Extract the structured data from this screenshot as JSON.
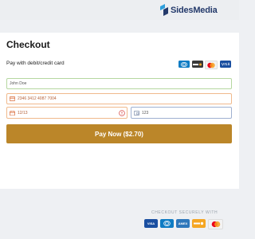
{
  "brand": {
    "name": "SidesMedia",
    "color": "#243a6b",
    "accent": "#2e9fdc"
  },
  "checkout": {
    "title": "Checkout",
    "subtitle": "Pay with debit/credit card",
    "card_brands": [
      "diners-club-icon",
      "discover-icon",
      "mastercard-icon",
      "visa-icon"
    ],
    "fields": {
      "name": {
        "value": "John Doe",
        "status": "valid"
      },
      "card_number": {
        "value": "2346 3412 4087 7004",
        "icon": "credit-card-icon",
        "status": "invalid"
      },
      "expiry": {
        "value": "12/13",
        "icon": "calendar-icon",
        "status": "invalid"
      },
      "cvc": {
        "value": "123",
        "icon": "cvc-card-icon",
        "status": "focused"
      }
    },
    "pay_button": {
      "label": "Pay Now ($2.70)",
      "color": "#bb8629"
    }
  },
  "footer": {
    "secure_label": "CHECKOUT SECURELY WITH",
    "brands": [
      {
        "label": "VISA",
        "icon": "visa-icon"
      },
      {
        "label": "",
        "icon": "diners-club-icon"
      },
      {
        "label": "AMEX",
        "icon": "amex-icon"
      },
      {
        "label": "",
        "icon": "discover-icon"
      },
      {
        "label": "",
        "icon": "mastercard-icon"
      }
    ]
  }
}
